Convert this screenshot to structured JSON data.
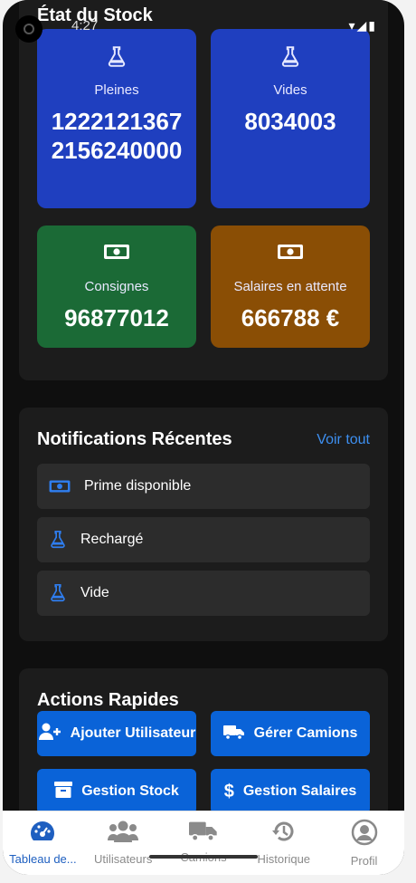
{
  "status": {
    "time": "4:27",
    "icons": "▾◢▮"
  },
  "stock": {
    "title": "État du Stock",
    "cards": [
      {
        "label": "Pleines",
        "value": "12221213672156240000",
        "icon": "flask-icon",
        "color": "#1f3fbf"
      },
      {
        "label": "Vides",
        "value": "8034003",
        "icon": "flask-icon",
        "color": "#1f3fbf"
      },
      {
        "label": "Consignes",
        "value": "96877012",
        "icon": "money-icon",
        "color": "#1b6a36"
      },
      {
        "label": "Salaires en attente",
        "value": "666788 €",
        "icon": "money-icon",
        "color": "#8a4e05"
      }
    ]
  },
  "notifications": {
    "title": "Notifications Récentes",
    "see_all": "Voir tout",
    "items": [
      {
        "text": "Prime disponible",
        "icon": "money-icon"
      },
      {
        "text": "Rechargé",
        "icon": "flask-icon"
      },
      {
        "text": "Vide",
        "icon": "flask-icon"
      }
    ]
  },
  "actions": {
    "title": "Actions Rapides",
    "buttons": [
      {
        "label": "Ajouter Utilisateur",
        "icon": "user-plus-icon"
      },
      {
        "label": "Gérer Camions",
        "icon": "truck-icon"
      },
      {
        "label": "Gestion Stock",
        "icon": "archive-icon"
      },
      {
        "label": "Gestion Salaires",
        "icon": "dollar-icon"
      }
    ]
  },
  "nav": {
    "items": [
      {
        "label": "Tableau de...",
        "icon": "dashboard-icon",
        "active": true
      },
      {
        "label": "Utilisateurs",
        "icon": "users-icon",
        "active": false
      },
      {
        "label": "Camions",
        "icon": "truck-icon",
        "active": false
      },
      {
        "label": "Historique",
        "icon": "history-icon",
        "active": false
      },
      {
        "label": "Profil",
        "icon": "profile-icon",
        "active": false
      }
    ],
    "active_color": "#1e5fc0"
  }
}
